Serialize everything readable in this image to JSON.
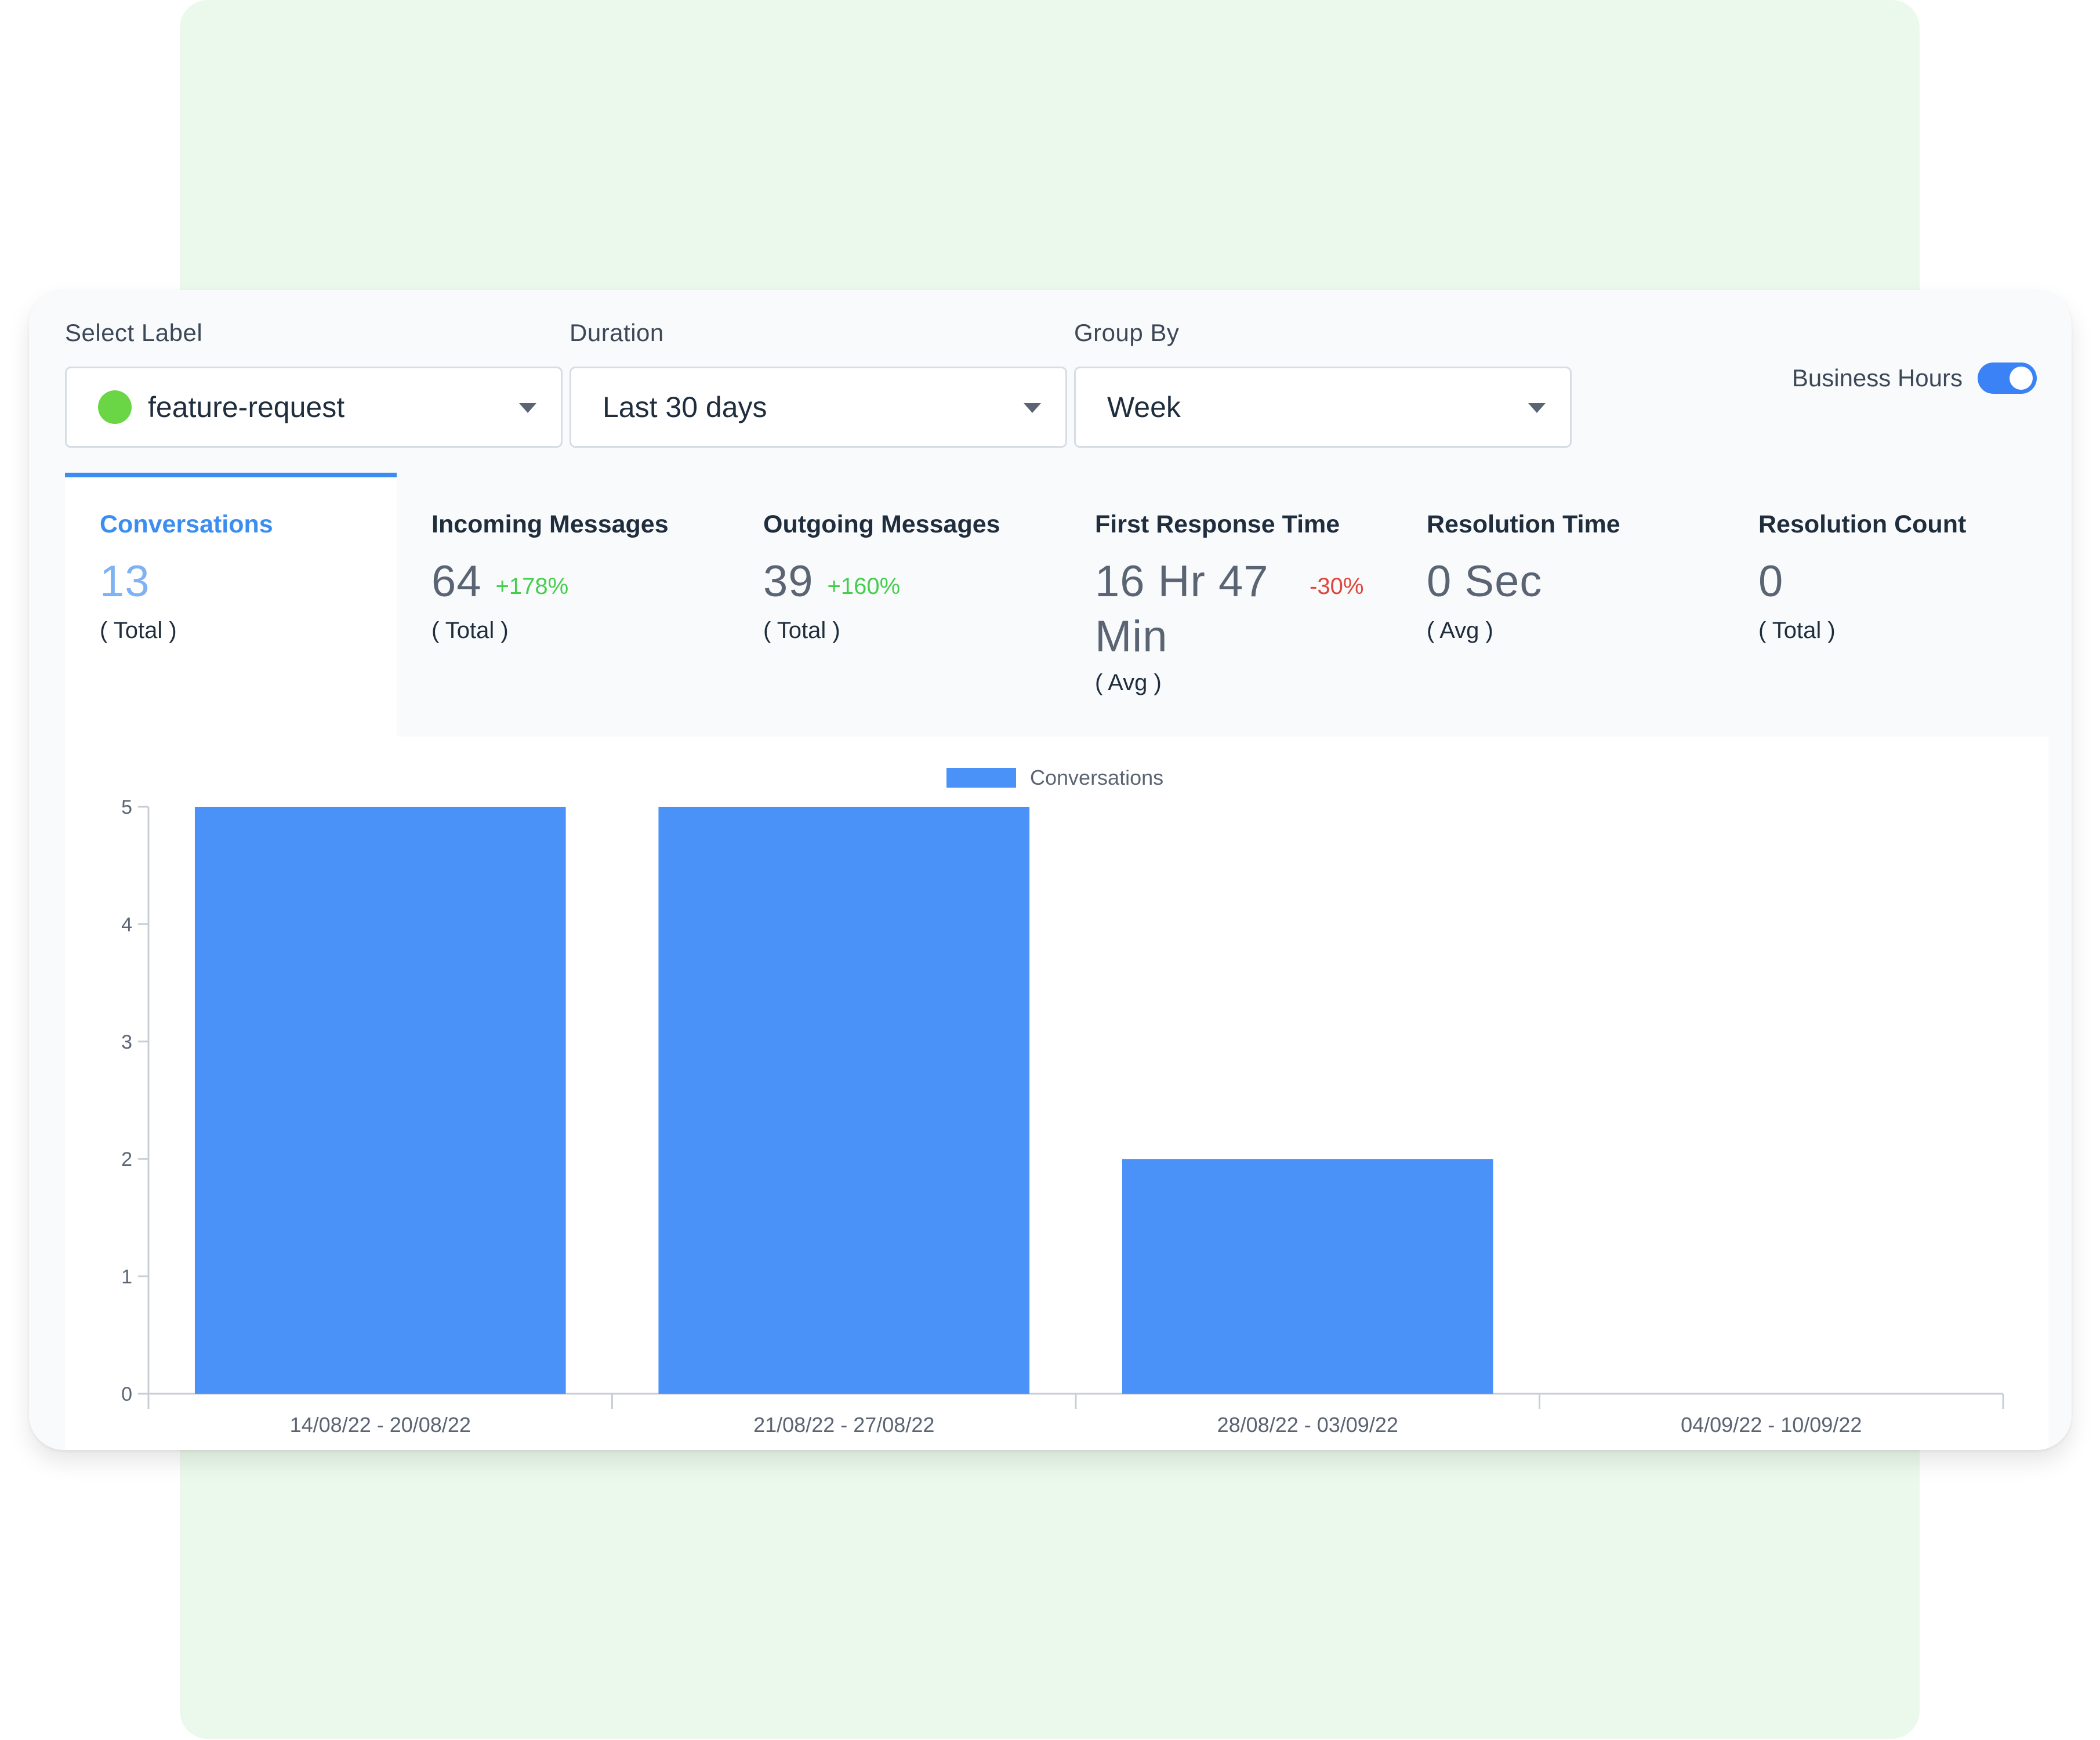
{
  "filters": {
    "label": {
      "title": "Select Label",
      "value": "feature-request",
      "dot_color": "#6bd645"
    },
    "duration": {
      "title": "Duration",
      "value": "Last 30 days"
    },
    "group_by": {
      "title": "Group By",
      "value": "Week"
    },
    "business_hours": {
      "label": "Business Hours",
      "enabled": true
    }
  },
  "metrics": [
    {
      "title": "Conversations",
      "value": "13",
      "change": "",
      "sub": "( Total )"
    },
    {
      "title": "Incoming Messages",
      "value": "64",
      "change": "+178%",
      "sub": "( Total )"
    },
    {
      "title": "Outgoing Messages",
      "value": "39",
      "change": "+160%",
      "sub": "( Total )"
    },
    {
      "title": "First Response Time",
      "value": "16 Hr 47",
      "value_line2": "Min",
      "change": "-30%",
      "sub": "( Avg )"
    },
    {
      "title": "Resolution Time",
      "value": "0 Sec",
      "change": "",
      "sub": "( Avg )"
    },
    {
      "title": "Resolution Count",
      "value": "0",
      "change": "",
      "sub": "( Total )"
    }
  ],
  "colors": {
    "accent": "#3b8eef",
    "bar": "#4a92f7",
    "positive": "#44ce4b",
    "negative": "#e0443b"
  },
  "chart_data": {
    "type": "bar",
    "categories": [
      "14/08/22 - 20/08/22",
      "21/08/22 - 27/08/22",
      "28/08/22 - 03/09/22",
      "04/09/22 - 10/09/22"
    ],
    "series": [
      {
        "name": "Conversations",
        "values": [
          5,
          5,
          2,
          0
        ]
      }
    ],
    "ylim": [
      0,
      5
    ],
    "yticks": [
      0,
      1,
      2,
      3,
      4,
      5
    ],
    "legend": "top-center",
    "grid": false,
    "title": "",
    "xlabel": "",
    "ylabel": ""
  }
}
